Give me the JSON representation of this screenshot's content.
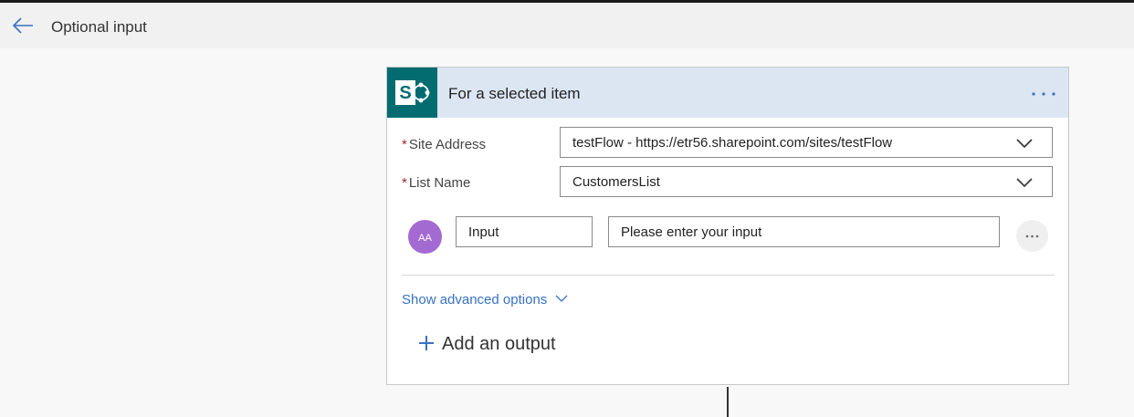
{
  "header": {
    "title": "Optional input",
    "back_icon": "back-arrow-icon"
  },
  "trigger": {
    "title": "For a selected item",
    "icon": "sharepoint-icon",
    "more_icon": "more-options-icon"
  },
  "fields": {
    "site_address": {
      "required_mark": "*",
      "label": "Site Address",
      "value": "testFlow - https://etr56.sharepoint.com/sites/testFlow"
    },
    "list_name": {
      "required_mark": "*",
      "label": "List Name",
      "value": "CustomersList"
    }
  },
  "input_row": {
    "avatar_text": "AA",
    "name_value": "Input",
    "prompt_value": "Please enter your input",
    "more_icon": "ellipsis-icon"
  },
  "advanced_label": "Show advanced options",
  "add_output_label": "Add an output",
  "colors": {
    "accent": "#3871c1",
    "header_bg": "#dce6f3",
    "sharepoint": "#036c70",
    "avatar": "#a36ad1",
    "required": "#a4262c"
  }
}
